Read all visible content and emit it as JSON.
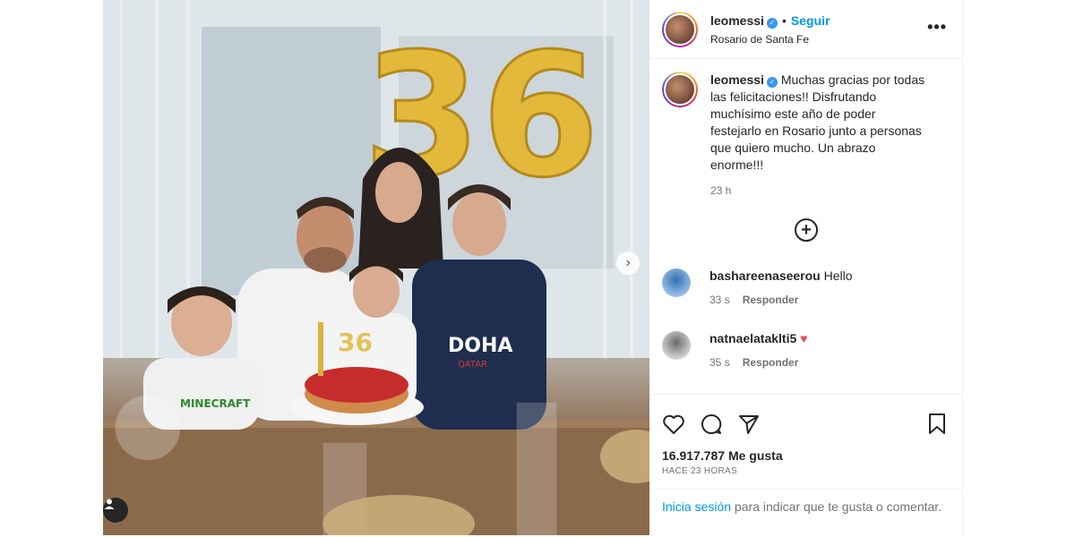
{
  "post": {
    "username": "leomessi",
    "follow_label": "Seguir",
    "location": "Rosario de Santa Fe",
    "more_label": "•••",
    "media_next_label": "›"
  },
  "caption": {
    "username": "leomessi",
    "text": "Muchas gracias por todas las felicitaciones!! Disfrutando muchísimo este año de poder festejarlo en Rosario junto a personas que quiero mucho. Un abrazo enorme!!!",
    "time": "23 h"
  },
  "comments": [
    {
      "username": "bashareenaseerou",
      "text": "Hello",
      "time": "33 s",
      "reply_label": "Responder",
      "emoji": ""
    },
    {
      "username": "natnaelataklti5",
      "text": "",
      "time": "35 s",
      "reply_label": "Responder",
      "emoji": "♥"
    }
  ],
  "stats": {
    "likes": "16.917.787 Me gusta",
    "ago": "HACE 23 HORAS"
  },
  "login_prompt": {
    "link": "Inicia sesión",
    "rest": " para indicar que te gusta o comentar."
  },
  "photo": {
    "balloon_text": "36",
    "candle_text": "36",
    "shirt_text": "DOHA",
    "shirt_subtext": "QATAR",
    "kid_shirt_text": "MINECRAFT"
  },
  "icons": {
    "verified": "verified-badge-icon",
    "load_more": "plus-circle-icon",
    "like": "heart-icon",
    "comment": "comment-icon",
    "share": "send-icon",
    "save": "bookmark-icon",
    "tag": "user-tag-icon"
  }
}
